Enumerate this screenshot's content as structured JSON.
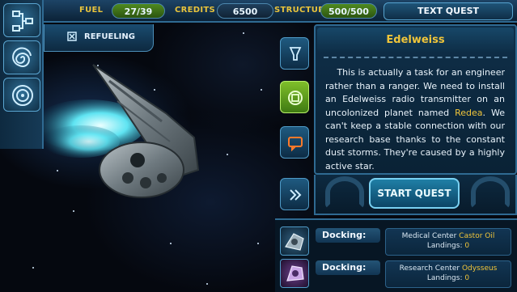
{
  "topbar": {
    "fuel_label": "FUEL",
    "fuel_value": "27/39",
    "credits_label": "CREDITS",
    "credits_value": "6500",
    "structure_label": "STRUCTURE",
    "structure_value": "500/500",
    "mode_title": "TEXT QUEST"
  },
  "left_menu": {
    "icons": [
      "network-map-icon",
      "spiral-icon",
      "radar-icon"
    ]
  },
  "refuel_tab": {
    "label": "REFUELING"
  },
  "quest": {
    "title": "Edelweiss",
    "text_part1": "This is actually a task for an engineer rather than a ranger. We need to install an Edelweiss radio transmitter on an uncolonized planet named ",
    "planet_name": "Redea",
    "text_part2": ". We can't keep a stable connection with our research base thanks to the constant dust storms. They're caused by a highly active star.",
    "start_button": "START QUEST"
  },
  "quest_tabs": [
    "goblet-icon",
    "target-icon",
    "chat-icon",
    "chevron-icon"
  ],
  "docking": [
    {
      "label": "Docking:",
      "place_type": "Medical Center",
      "place_name": "Castor Oil",
      "landings_label": "Landings:",
      "landings_value": "0"
    },
    {
      "label": "Docking:",
      "place_type": "Research Center",
      "place_name": "Odysseus",
      "landings_label": "Landings:",
      "landings_value": "0"
    }
  ],
  "colors": {
    "accent_gold": "#f0c53a",
    "fuel_green": "#4f8a20",
    "frame_blue": "#2f6a92"
  }
}
